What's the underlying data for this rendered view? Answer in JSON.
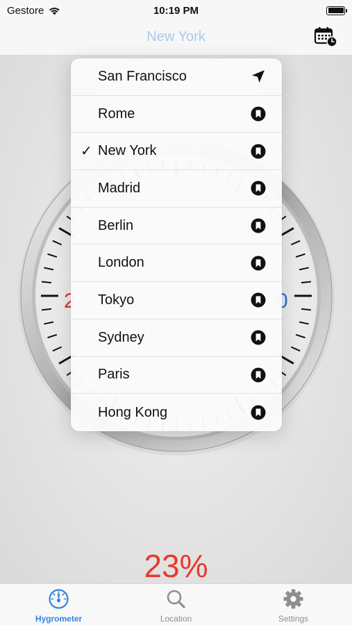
{
  "status_bar": {
    "carrier": "Gestore",
    "time": "10:19 PM"
  },
  "nav": {
    "title": "New York",
    "calendar_icon": "calendar-clock-icon"
  },
  "reading": {
    "value": "23%",
    "state": "dry",
    "color": "#e63a2f"
  },
  "dropdown": {
    "items": [
      {
        "label": "San Francisco",
        "icon": "location-arrow-icon",
        "checked": false
      },
      {
        "label": "Rome",
        "icon": "bookmark-icon",
        "checked": false
      },
      {
        "label": "New York",
        "icon": "bookmark-icon",
        "checked": true
      },
      {
        "label": "Madrid",
        "icon": "bookmark-icon",
        "checked": false
      },
      {
        "label": "Berlin",
        "icon": "bookmark-icon",
        "checked": false
      },
      {
        "label": "London",
        "icon": "bookmark-icon",
        "checked": false
      },
      {
        "label": "Tokyo",
        "icon": "bookmark-icon",
        "checked": false
      },
      {
        "label": "Sydney",
        "icon": "bookmark-icon",
        "checked": false
      },
      {
        "label": "Paris",
        "icon": "bookmark-icon",
        "checked": false
      },
      {
        "label": "Hong Kong",
        "icon": "bookmark-icon",
        "checked": false
      }
    ],
    "check_mark": "✓"
  },
  "tabs": [
    {
      "label": "Hygrometer",
      "icon": "gauge-icon",
      "active": true
    },
    {
      "label": "Location",
      "icon": "magnifier-icon",
      "active": false
    },
    {
      "label": "Settings",
      "icon": "gear-icon",
      "active": false
    }
  ],
  "colors": {
    "accent": "#2f86dc",
    "reading": "#e63a2f",
    "nav_title": "#a9c9ee"
  }
}
